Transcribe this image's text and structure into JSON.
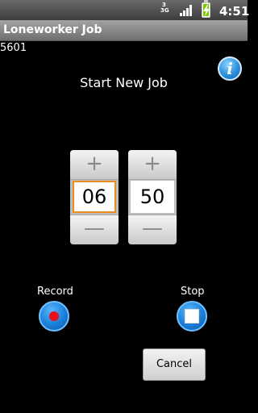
{
  "status_bar": {
    "network_line1": "3",
    "network_line2": "3G",
    "signal_icon": "signal-icon",
    "battery_icon": "battery-charging-icon",
    "time": "4:51"
  },
  "app": {
    "title": "Loneworker Job",
    "job_id": "5601",
    "info_icon_glyph": "i"
  },
  "main": {
    "heading": "Start New Job",
    "time_picker": {
      "hours": "06",
      "minutes": "50",
      "increment_glyph": "+",
      "decrement_glyph": "—"
    },
    "record_label": "Record",
    "stop_label": "Stop",
    "cancel_label": "Cancel"
  },
  "colors": {
    "background": "#000000",
    "focus_border": "#f08c1e",
    "button_blue": "#1a7fd8",
    "record_red": "#e8101a"
  }
}
